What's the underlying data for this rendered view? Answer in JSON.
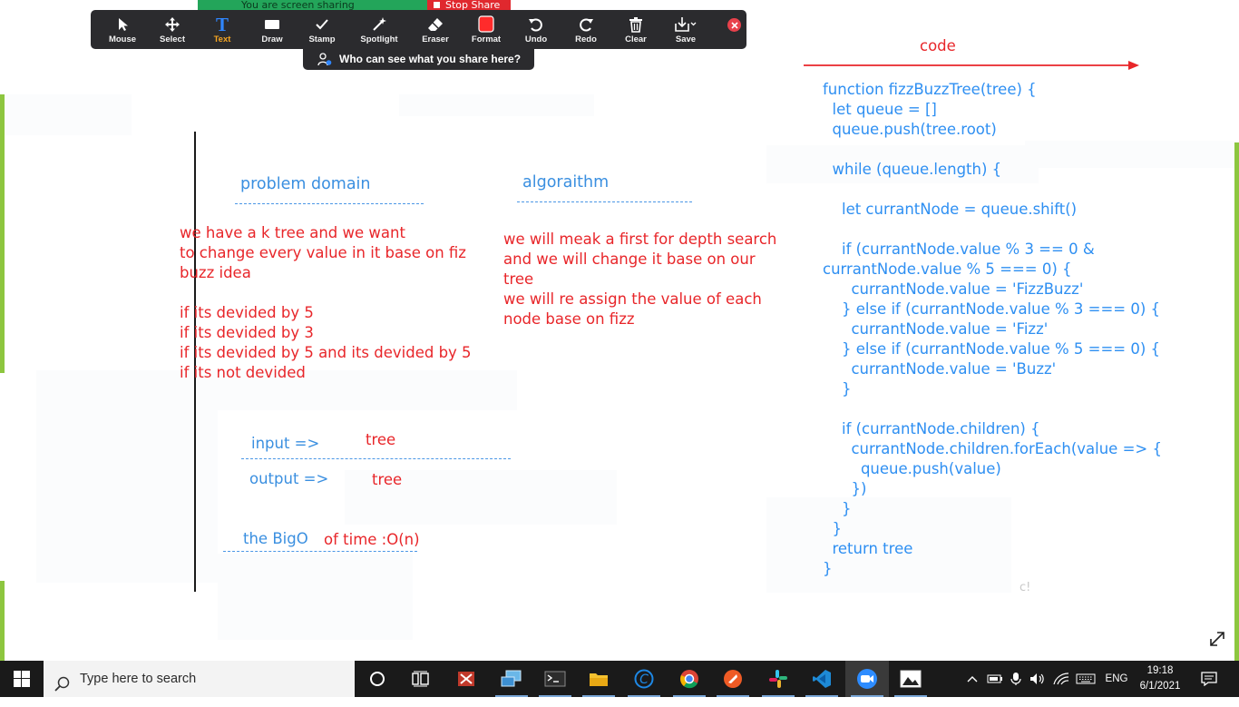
{
  "share_bar": {
    "sharing_text": "You are screen sharing",
    "stop_label": "Stop Share"
  },
  "toolbar": {
    "tools": [
      {
        "label": "Mouse",
        "icon": "cursor-arrow-icon"
      },
      {
        "label": "Select",
        "icon": "move-arrows-icon"
      },
      {
        "label": "Text",
        "icon": "text-t-icon",
        "active": true
      },
      {
        "label": "Draw",
        "icon": "draw-rect-icon"
      },
      {
        "label": "Stamp",
        "icon": "checkmark-icon"
      },
      {
        "label": "Spotlight",
        "icon": "magic-wand-icon"
      },
      {
        "label": "Eraser",
        "icon": "eraser-icon"
      },
      {
        "label": "Format",
        "icon": "color-square-icon"
      },
      {
        "label": "Undo",
        "icon": "undo-icon"
      },
      {
        "label": "Redo",
        "icon": "redo-icon"
      },
      {
        "label": "Clear",
        "icon": "trash-icon"
      },
      {
        "label": "Save",
        "icon": "save-download-icon"
      }
    ],
    "format_color": "#ff2b2b",
    "active_color": "#f5a623",
    "who_can_see": "Who can see what you share here?"
  },
  "whiteboard": {
    "code_label": "code",
    "problem_domain_heading": "problem domain",
    "algorithm_heading": "algoraithm",
    "problem_lines": [
      "we have a k tree and we want",
      "to change every value in it base on fiz",
      "buzz idea",
      "",
      "if its devided by 5",
      "if its devided by 3",
      "if its devided by 5 and its devided by 5",
      "if its not devided"
    ],
    "algorithm_lines": [
      "we will meak a first for depth search",
      "and we will change it base on our",
      "tree",
      "we will re assign the value of each",
      "node base on fizz"
    ],
    "input_label": "input =>",
    "input_value": "tree",
    "output_label": "output =>",
    "output_value": "tree",
    "bigo_label": "the BigO",
    "bigo_value": "of time :O(n)",
    "code_lines": [
      "function fizzBuzzTree(tree) {",
      "  let queue = []",
      "  queue.push(tree.root)",
      "",
      "  while (queue.length) {",
      "",
      "    let currantNode = queue.shift()",
      "",
      "    if (currantNode.value % 3 == 0 &",
      "currantNode.value % 5 === 0) {",
      "      currantNode.value = 'FizzBuzz'",
      "    } else if (currantNode.value % 3 === 0) {",
      "      currantNode.value = 'Fizz'",
      "    } else if (currantNode.value % 5 === 0) {",
      "      currantNode.value = 'Buzz'",
      "    }",
      "",
      "    if (currantNode.children) {",
      "      currantNode.children.forEach(value => {",
      "        queue.push(value)",
      "      })",
      "    }",
      "  }",
      "  return tree",
      "}"
    ],
    "colors": {
      "red": "#e8262a",
      "blue": "#3a8fe0",
      "green_bar": "#8dc63f"
    }
  },
  "taskbar": {
    "search_placeholder": "Type here to search",
    "apps": [
      "cortana-icon",
      "task-view-icon",
      "cmake-app-icon",
      "network-pc-icon",
      "terminal-icon",
      "file-explorer-icon",
      "c-app-icon",
      "chrome-icon",
      "postman-icon",
      "slack-icon",
      "vscode-icon",
      "zoom-icon",
      "photos-icon"
    ],
    "language": "ENG",
    "time": "19:18",
    "date": "6/1/2021"
  }
}
